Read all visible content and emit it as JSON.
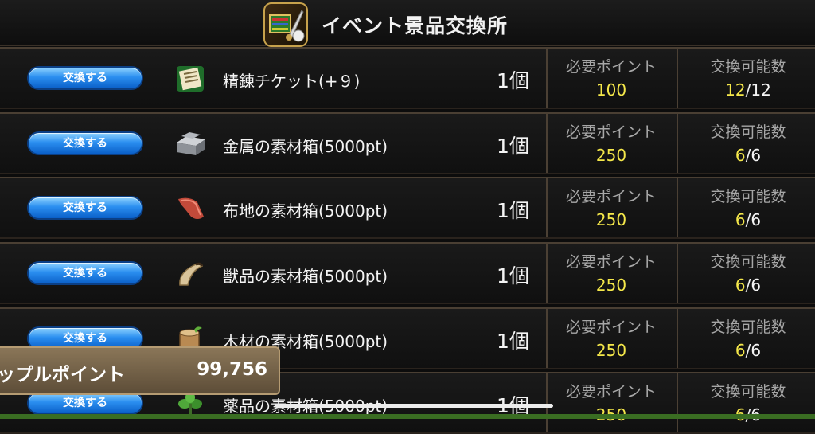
{
  "header": {
    "title": "イベント景品交換所",
    "icon": "event-shop-icon"
  },
  "labels": {
    "required_points": "必要ポイント",
    "exchangeable_count": "交換可能数"
  },
  "rows": [
    {
      "button": "交換する",
      "icon": "ticket-icon",
      "name": "精錬チケット(+９)",
      "qty": "1個",
      "points": "100",
      "current": "12",
      "max": "/12"
    },
    {
      "button": "交換する",
      "icon": "metal-ingot-icon",
      "name": "金属の素材箱(5000pt)",
      "qty": "1個",
      "points": "250",
      "current": "6",
      "max": "/6"
    },
    {
      "button": "交換する",
      "icon": "cloth-icon",
      "name": "布地の素材箱(5000pt)",
      "qty": "1個",
      "points": "250",
      "current": "6",
      "max": "/6"
    },
    {
      "button": "交換する",
      "icon": "horn-icon",
      "name": "獣品の素材箱(5000pt)",
      "qty": "1個",
      "points": "250",
      "current": "6",
      "max": "/6"
    },
    {
      "button": "交換する",
      "icon": "wood-log-icon",
      "name": "木材の素材箱(5000pt)",
      "qty": "1個",
      "points": "250",
      "current": "6",
      "max": "/6"
    },
    {
      "button": "交換する",
      "icon": "herb-icon",
      "name": "薬品の素材箱(5000pt)",
      "qty": "1個",
      "points": "250",
      "current": "6",
      "max": "/6"
    }
  ],
  "points_panel": {
    "label": "ップルポイント",
    "value": "99,756"
  },
  "colors": {
    "accent_yellow": "#f5e84a",
    "button_blue": "#2b8ff0",
    "panel_brown": "#7a6648"
  }
}
